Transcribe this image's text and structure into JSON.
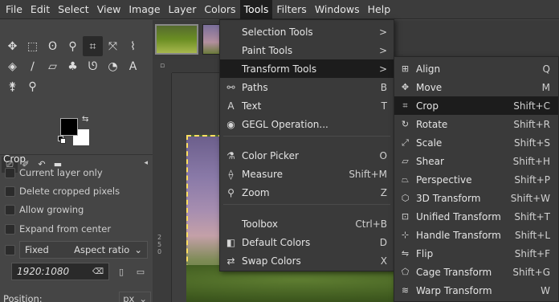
{
  "menubar": [
    "File",
    "Edit",
    "Select",
    "View",
    "Image",
    "Layer",
    "Colors",
    "Tools",
    "Filters",
    "Windows",
    "Help"
  ],
  "toolbox": {
    "tools": [
      "move-icon",
      "rect-select-icon",
      "lasso-icon",
      "fuzzy-select-icon",
      "crop-icon",
      "transform-icon",
      "warp-icon",
      "bucket-icon",
      "paintbrush-icon",
      "eraser-icon",
      "clone-icon",
      "smudge-icon",
      "dodge-icon",
      "text-icon",
      "color-picker-icon",
      "zoom-icon"
    ],
    "tool_glyphs": [
      "✥",
      "⬚",
      "ʘ",
      "⚲",
      "⌗",
      "⤧",
      "⌇",
      "◈",
      "∕",
      "▱",
      "♣",
      "ᘎ",
      "◔",
      "A",
      "⚵",
      "⚲"
    ]
  },
  "tool_options": {
    "title": "Crop",
    "options": [
      "Current layer only",
      "Delete cropped pixels",
      "Allow growing",
      "Expand from center"
    ],
    "fixed_label": "Fixed",
    "fixed_mode": "Aspect ratio",
    "ratio_value": "1920:1080",
    "position_label": "Position:",
    "unit": "px"
  },
  "ruler_v_labels": [
    "2",
    "5",
    "0"
  ],
  "tools_menu": [
    {
      "label": "Selection Tools",
      "icon": "",
      "right": ">",
      "has_sub": true
    },
    {
      "label": "Paint Tools",
      "icon": "",
      "right": ">",
      "has_sub": true
    },
    {
      "label": "Transform Tools",
      "icon": "",
      "right": ">",
      "has_sub": true,
      "highlighted": true
    },
    {
      "label": "Paths",
      "icon": "⚯",
      "right": "B"
    },
    {
      "label": "Text",
      "icon": "A",
      "right": "T"
    },
    {
      "label": "GEGL Operation...",
      "icon": "◉",
      "right": ""
    },
    {
      "label": "Color Picker",
      "icon": "⚗",
      "right": "O"
    },
    {
      "label": "Measure",
      "icon": "⟠",
      "right": "Shift+M"
    },
    {
      "label": "Zoom",
      "icon": "⚲",
      "right": "Z"
    },
    {
      "label": "Toolbox",
      "icon": "",
      "right": "Ctrl+B"
    },
    {
      "label": "Default Colors",
      "icon": "◧",
      "right": "D"
    },
    {
      "label": "Swap Colors",
      "icon": "⇄",
      "right": "X"
    }
  ],
  "transform_submenu": [
    {
      "label": "Align",
      "icon": "⊞",
      "key": "Q"
    },
    {
      "label": "Move",
      "icon": "✥",
      "key": "M"
    },
    {
      "label": "Crop",
      "icon": "⌗",
      "key": "Shift+C",
      "highlighted": true
    },
    {
      "label": "Rotate",
      "icon": "↻",
      "key": "Shift+R"
    },
    {
      "label": "Scale",
      "icon": "⤢",
      "key": "Shift+S"
    },
    {
      "label": "Shear",
      "icon": "▱",
      "key": "Shift+H"
    },
    {
      "label": "Perspective",
      "icon": "⏢",
      "key": "Shift+P"
    },
    {
      "label": "3D Transform",
      "icon": "⬡",
      "key": "Shift+W"
    },
    {
      "label": "Unified Transform",
      "icon": "⊡",
      "key": "Shift+T"
    },
    {
      "label": "Handle Transform",
      "icon": "⊹",
      "key": "Shift+L"
    },
    {
      "label": "Flip",
      "icon": "⇋",
      "key": "Shift+F"
    },
    {
      "label": "Cage Transform",
      "icon": "⬠",
      "key": "Shift+G"
    },
    {
      "label": "Warp Transform",
      "icon": "≋",
      "key": "W"
    }
  ]
}
